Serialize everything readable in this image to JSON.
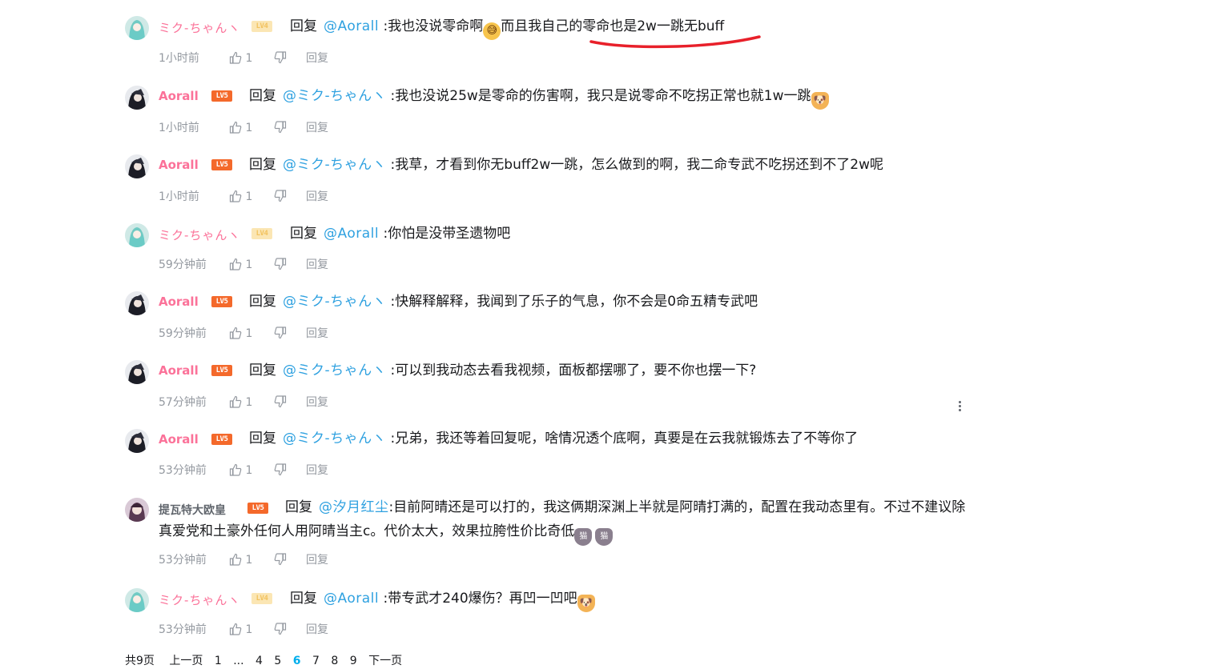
{
  "comments": [
    {
      "user": "ミク-ちゃんヽ",
      "level": "LV4",
      "reply_word": "回复",
      "at": "@Aorall",
      "text_a": ":我也没说零命啊",
      "text_b": "而且我自己的零命也是2w一跳无buff",
      "time": "1小时前",
      "likes": "1",
      "reply_label": "回复",
      "emoji": "sweat-face"
    },
    {
      "user": "Aorall",
      "level": "LV5",
      "reply_word": "回复",
      "at": "@ミク-ちゃんヽ",
      "text_a": ":我也没说25w是零命的伤害啊，我只是说零命不吃拐正常也就1w一跳",
      "time": "1小时前",
      "likes": "1",
      "reply_label": "回复",
      "emoji": "shiba-face"
    },
    {
      "user": "Aorall",
      "level": "LV5",
      "reply_word": "回复",
      "at": "@ミク-ちゃんヽ",
      "text_a": ":我草，才看到你无buff2w一跳，怎么做到的啊，我二命专武不吃拐还到不了2w呢",
      "time": "1小时前",
      "likes": "1",
      "reply_label": "回复"
    },
    {
      "user": "ミク-ちゃんヽ",
      "level": "LV4",
      "reply_word": "回复",
      "at": "@Aorall",
      "text_a": ":你怕是没带圣遗物吧",
      "time": "59分钟前",
      "likes": "1",
      "reply_label": "回复"
    },
    {
      "user": "Aorall",
      "level": "LV5",
      "reply_word": "回复",
      "at": "@ミク-ちゃんヽ",
      "text_a": ":快解释解释，我闻到了乐子的气息，你不会是0命五精专武吧",
      "time": "59分钟前",
      "likes": "1",
      "reply_label": "回复"
    },
    {
      "user": "Aorall",
      "level": "LV5",
      "reply_word": "回复",
      "at": "@ミク-ちゃんヽ",
      "text_a": ":可以到我动态去看我视频，面板都摆哪了，要不你也摆一下?",
      "time": "57分钟前",
      "likes": "1",
      "reply_label": "回复"
    },
    {
      "user": "Aorall",
      "level": "LV5",
      "reply_word": "回复",
      "at": "@ミク-ちゃんヽ",
      "text_a": ":兄弟，我还等着回复呢，啥情况透个底啊，真要是在云我就锻炼去了不等你了",
      "time": "53分钟前",
      "likes": "1",
      "reply_label": "回复"
    },
    {
      "user": "提瓦特大欧皇",
      "level": "LV5",
      "reply_word": "回复",
      "at": "@汐月红尘",
      "text_a": ":目前阿晴还是可以打的，我这俩期深渊上半就是阿晴打满的，配置在我动态里有。不过不建议除",
      "text_b": "真爱党和土豪外任何人用阿晴当主c。代价太大，效果拉胯性价比奇低",
      "time": "53分钟前",
      "likes": "1",
      "reply_label": "回复",
      "emoji": "cat-face"
    },
    {
      "user": "ミク-ちゃんヽ",
      "level": "LV4",
      "reply_word": "回复",
      "at": "@Aorall",
      "text_a": ":带专武才240爆伤？再凹一凹吧",
      "time": "53分钟前",
      "likes": "1",
      "reply_label": "回复",
      "emoji": "shiba-face"
    }
  ],
  "pagination": {
    "total": "共9页",
    "prev": "上一页",
    "first": "1",
    "ellipsis": "...",
    "pages": [
      "4",
      "5",
      "6",
      "7",
      "8",
      "9"
    ],
    "current": "6",
    "next": "下一页"
  },
  "colors": {
    "username_pink": "#fb7299",
    "username_dark": "#fb7299",
    "mention": "#2fa1e0",
    "meta": "#9499a0",
    "annotation_red": "#e8202a"
  }
}
